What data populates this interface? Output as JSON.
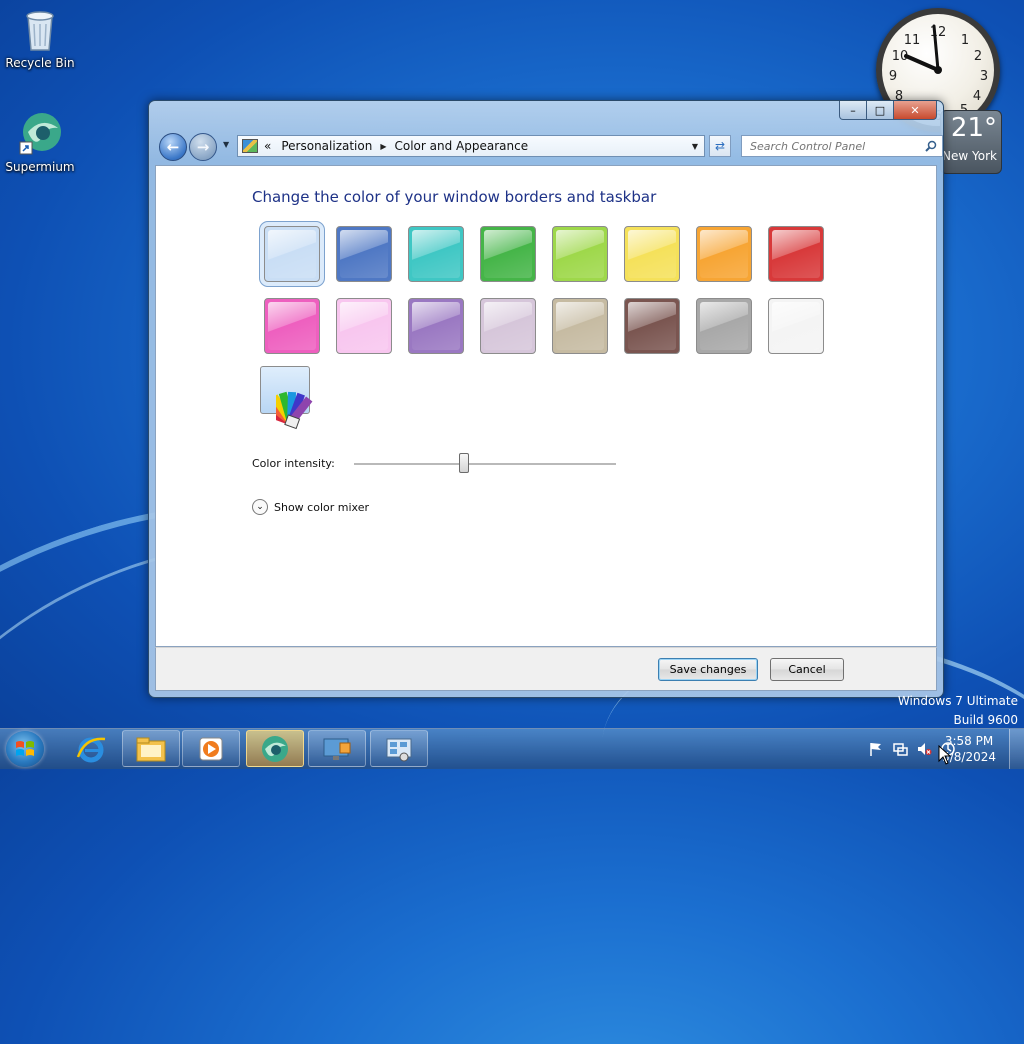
{
  "desktop": {
    "icons": [
      {
        "label": "Recycle Bin",
        "icon": "recycle-bin-icon"
      },
      {
        "label": "Supermium",
        "icon": "supermium-icon"
      }
    ],
    "watermark_line1": "Windows 7 Ultimate",
    "watermark_line2": "Build 9600"
  },
  "gadgets": {
    "weather": {
      "temperature": "21°",
      "city": "New York"
    },
    "clock": {
      "time_shown": "11:59"
    }
  },
  "window": {
    "caption": {
      "minimize": "–",
      "maximize": "□",
      "close": "✕"
    },
    "breadcrumb": {
      "overflow": "«",
      "items": [
        "Personalization",
        "Color and Appearance"
      ]
    },
    "search_placeholder": "Search Control Panel",
    "heading": "Change the color of your window borders and taskbar",
    "swatches": [
      {
        "name": "sky",
        "color": "#c9def5",
        "selected": true
      },
      {
        "name": "twilight",
        "color": "#4f78c4"
      },
      {
        "name": "sea",
        "color": "#3fc7c4"
      },
      {
        "name": "leaf",
        "color": "#45b548"
      },
      {
        "name": "lime",
        "color": "#9ed84a"
      },
      {
        "name": "sun",
        "color": "#f5e15a"
      },
      {
        "name": "pumpkin",
        "color": "#f7a534"
      },
      {
        "name": "ruby",
        "color": "#d8393a"
      },
      {
        "name": "fuchsia",
        "color": "#ee5fbf"
      },
      {
        "name": "blush",
        "color": "#f8c6ef"
      },
      {
        "name": "violet",
        "color": "#9a78c2"
      },
      {
        "name": "lavender",
        "color": "#d6c6da"
      },
      {
        "name": "taupe",
        "color": "#c6bba2"
      },
      {
        "name": "chocolate",
        "color": "#7a5550"
      },
      {
        "name": "slate",
        "color": "#a8a8a8"
      },
      {
        "name": "frost",
        "color": "#f4f4f4"
      }
    ],
    "intensity_label": "Color intensity:",
    "intensity_value": 0.42,
    "mixer_label": "Show color mixer",
    "save_label": "Save changes",
    "cancel_label": "Cancel"
  },
  "taskbar": {
    "time": "3:58 PM",
    "date": "5/8/2024",
    "apps": [
      {
        "name": "internet-explorer-icon",
        "state": "plain"
      },
      {
        "name": "file-explorer-icon",
        "state": "pinned"
      },
      {
        "name": "media-player-icon",
        "state": "pinned"
      },
      {
        "name": "supermium-icon",
        "state": "active"
      },
      {
        "name": "remote-desktop-icon",
        "state": "pinned"
      },
      {
        "name": "control-panel-icon",
        "state": "pinned"
      }
    ]
  }
}
